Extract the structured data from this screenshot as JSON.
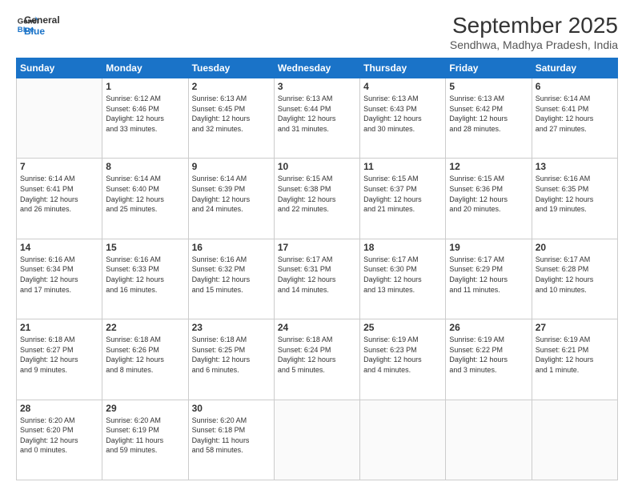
{
  "logo": {
    "line1": "General",
    "line2": "Blue"
  },
  "title": "September 2025",
  "subtitle": "Sendhwa, Madhya Pradesh, India",
  "weekdays": [
    "Sunday",
    "Monday",
    "Tuesday",
    "Wednesday",
    "Thursday",
    "Friday",
    "Saturday"
  ],
  "weeks": [
    [
      {
        "day": "",
        "info": ""
      },
      {
        "day": "1",
        "info": "Sunrise: 6:12 AM\nSunset: 6:46 PM\nDaylight: 12 hours\nand 33 minutes."
      },
      {
        "day": "2",
        "info": "Sunrise: 6:13 AM\nSunset: 6:45 PM\nDaylight: 12 hours\nand 32 minutes."
      },
      {
        "day": "3",
        "info": "Sunrise: 6:13 AM\nSunset: 6:44 PM\nDaylight: 12 hours\nand 31 minutes."
      },
      {
        "day": "4",
        "info": "Sunrise: 6:13 AM\nSunset: 6:43 PM\nDaylight: 12 hours\nand 30 minutes."
      },
      {
        "day": "5",
        "info": "Sunrise: 6:13 AM\nSunset: 6:42 PM\nDaylight: 12 hours\nand 28 minutes."
      },
      {
        "day": "6",
        "info": "Sunrise: 6:14 AM\nSunset: 6:41 PM\nDaylight: 12 hours\nand 27 minutes."
      }
    ],
    [
      {
        "day": "7",
        "info": "Sunrise: 6:14 AM\nSunset: 6:41 PM\nDaylight: 12 hours\nand 26 minutes."
      },
      {
        "day": "8",
        "info": "Sunrise: 6:14 AM\nSunset: 6:40 PM\nDaylight: 12 hours\nand 25 minutes."
      },
      {
        "day": "9",
        "info": "Sunrise: 6:14 AM\nSunset: 6:39 PM\nDaylight: 12 hours\nand 24 minutes."
      },
      {
        "day": "10",
        "info": "Sunrise: 6:15 AM\nSunset: 6:38 PM\nDaylight: 12 hours\nand 22 minutes."
      },
      {
        "day": "11",
        "info": "Sunrise: 6:15 AM\nSunset: 6:37 PM\nDaylight: 12 hours\nand 21 minutes."
      },
      {
        "day": "12",
        "info": "Sunrise: 6:15 AM\nSunset: 6:36 PM\nDaylight: 12 hours\nand 20 minutes."
      },
      {
        "day": "13",
        "info": "Sunrise: 6:16 AM\nSunset: 6:35 PM\nDaylight: 12 hours\nand 19 minutes."
      }
    ],
    [
      {
        "day": "14",
        "info": "Sunrise: 6:16 AM\nSunset: 6:34 PM\nDaylight: 12 hours\nand 17 minutes."
      },
      {
        "day": "15",
        "info": "Sunrise: 6:16 AM\nSunset: 6:33 PM\nDaylight: 12 hours\nand 16 minutes."
      },
      {
        "day": "16",
        "info": "Sunrise: 6:16 AM\nSunset: 6:32 PM\nDaylight: 12 hours\nand 15 minutes."
      },
      {
        "day": "17",
        "info": "Sunrise: 6:17 AM\nSunset: 6:31 PM\nDaylight: 12 hours\nand 14 minutes."
      },
      {
        "day": "18",
        "info": "Sunrise: 6:17 AM\nSunset: 6:30 PM\nDaylight: 12 hours\nand 13 minutes."
      },
      {
        "day": "19",
        "info": "Sunrise: 6:17 AM\nSunset: 6:29 PM\nDaylight: 12 hours\nand 11 minutes."
      },
      {
        "day": "20",
        "info": "Sunrise: 6:17 AM\nSunset: 6:28 PM\nDaylight: 12 hours\nand 10 minutes."
      }
    ],
    [
      {
        "day": "21",
        "info": "Sunrise: 6:18 AM\nSunset: 6:27 PM\nDaylight: 12 hours\nand 9 minutes."
      },
      {
        "day": "22",
        "info": "Sunrise: 6:18 AM\nSunset: 6:26 PM\nDaylight: 12 hours\nand 8 minutes."
      },
      {
        "day": "23",
        "info": "Sunrise: 6:18 AM\nSunset: 6:25 PM\nDaylight: 12 hours\nand 6 minutes."
      },
      {
        "day": "24",
        "info": "Sunrise: 6:18 AM\nSunset: 6:24 PM\nDaylight: 12 hours\nand 5 minutes."
      },
      {
        "day": "25",
        "info": "Sunrise: 6:19 AM\nSunset: 6:23 PM\nDaylight: 12 hours\nand 4 minutes."
      },
      {
        "day": "26",
        "info": "Sunrise: 6:19 AM\nSunset: 6:22 PM\nDaylight: 12 hours\nand 3 minutes."
      },
      {
        "day": "27",
        "info": "Sunrise: 6:19 AM\nSunset: 6:21 PM\nDaylight: 12 hours\nand 1 minute."
      }
    ],
    [
      {
        "day": "28",
        "info": "Sunrise: 6:20 AM\nSunset: 6:20 PM\nDaylight: 12 hours\nand 0 minutes."
      },
      {
        "day": "29",
        "info": "Sunrise: 6:20 AM\nSunset: 6:19 PM\nDaylight: 11 hours\nand 59 minutes."
      },
      {
        "day": "30",
        "info": "Sunrise: 6:20 AM\nSunset: 6:18 PM\nDaylight: 11 hours\nand 58 minutes."
      },
      {
        "day": "",
        "info": ""
      },
      {
        "day": "",
        "info": ""
      },
      {
        "day": "",
        "info": ""
      },
      {
        "day": "",
        "info": ""
      }
    ]
  ]
}
